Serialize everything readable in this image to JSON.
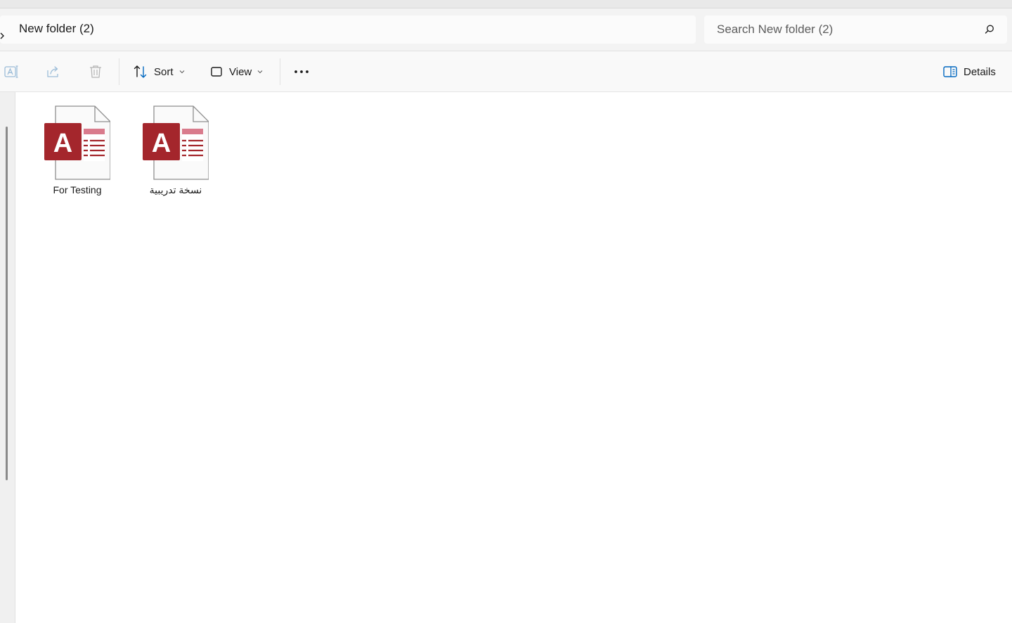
{
  "address": {
    "path": "New folder (2)"
  },
  "search": {
    "placeholder": "Search New folder (2)"
  },
  "toolbar": {
    "sort_label": "Sort",
    "view_label": "View",
    "details_label": "Details",
    "icons": [
      "rename-icon",
      "share-icon",
      "delete-icon",
      "sort-icon",
      "view-icon",
      "more-icon",
      "details-pane-icon"
    ]
  },
  "files": [
    {
      "name": "For Testing",
      "icon": "access-database-icon"
    },
    {
      "name": "نسخة تدريبية",
      "icon": "access-database-icon"
    }
  ],
  "colors": {
    "access_red": "#A4262C",
    "access_pink": "#D97B8C",
    "accent_blue": "#0067C0"
  }
}
